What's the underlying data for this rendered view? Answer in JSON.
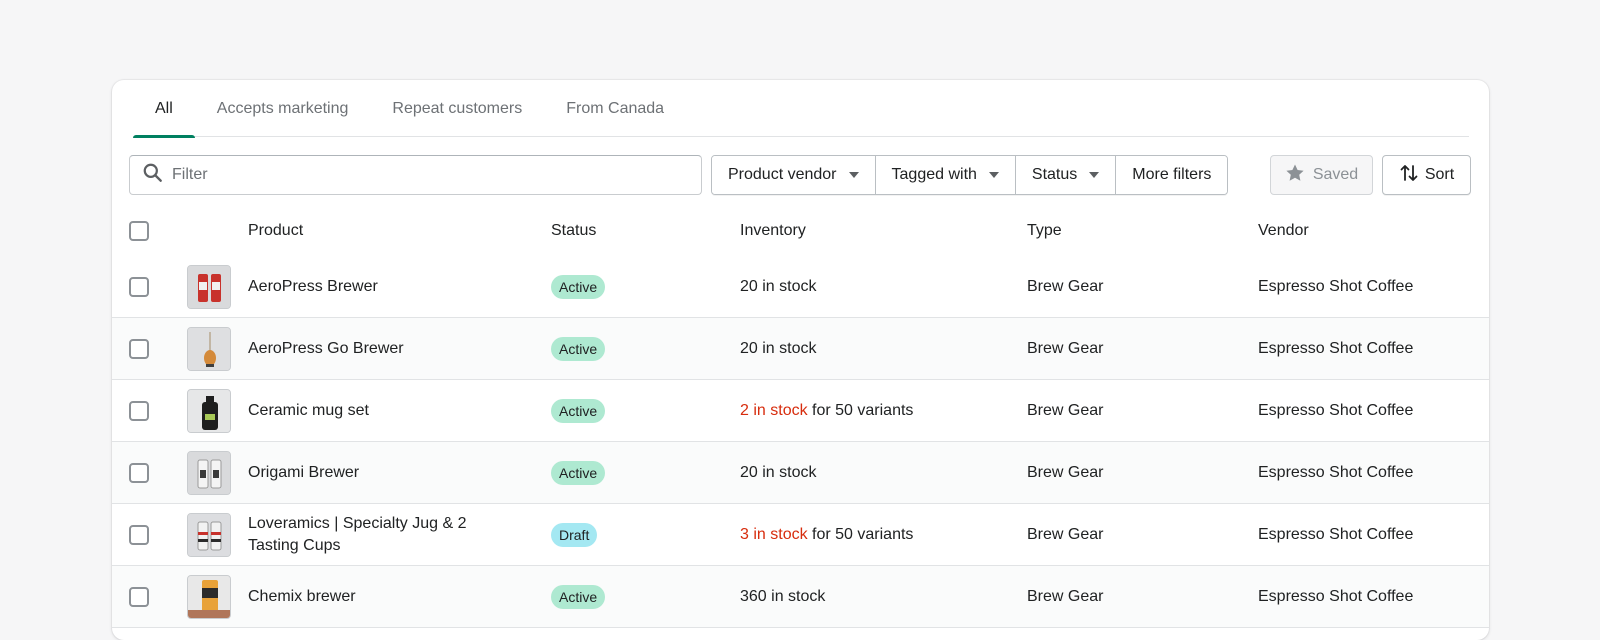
{
  "tabs": [
    {
      "label": "All",
      "active": true
    },
    {
      "label": "Accepts marketing",
      "active": false
    },
    {
      "label": "Repeat customers",
      "active": false
    },
    {
      "label": "From Canada",
      "active": false
    }
  ],
  "filter": {
    "placeholder": "Filter"
  },
  "filter_buttons": {
    "product_vendor": "Product vendor",
    "tagged_with": "Tagged with",
    "status": "Status",
    "more_filters": "More filters"
  },
  "saved_label": "Saved",
  "sort_label": "Sort",
  "columns": {
    "product": "Product",
    "status": "Status",
    "inventory": "Inventory",
    "type": "Type",
    "vendor": "Vendor"
  },
  "rows": [
    {
      "name": "AeroPress Brewer",
      "status": "Active",
      "inv_low": "",
      "inv_text": "20 in stock",
      "type": "Brew Gear",
      "vendor": "Espresso Shot Coffee",
      "thumb_icon": "red-cans-icon"
    },
    {
      "name": "AeroPress Go Brewer",
      "status": "Active",
      "inv_low": "",
      "inv_text": "20 in stock",
      "type": "Brew Gear",
      "vendor": "Espresso Shot Coffee",
      "thumb_icon": "hanging-ornament-icon"
    },
    {
      "name": "Ceramic mug set",
      "status": "Active",
      "inv_low": "2 in stock",
      "inv_text": " for 50 variants",
      "type": "Brew Gear",
      "vendor": "Espresso Shot Coffee",
      "thumb_icon": "black-bottle-icon"
    },
    {
      "name": "Origami Brewer",
      "status": "Active",
      "inv_low": "",
      "inv_text": "20 in stock",
      "type": "Brew Gear",
      "vendor": "Espresso Shot Coffee",
      "thumb_icon": "white-cans-icon"
    },
    {
      "name": "Loveramics | Specialty Jug & 2 Tasting Cups",
      "status": "Draft",
      "inv_low": "3 in stock",
      "inv_text": " for 50 variants",
      "type": "Brew Gear",
      "vendor": "Espresso Shot Coffee",
      "thumb_icon": "striped-cans-icon"
    },
    {
      "name": "Chemix brewer",
      "status": "Active",
      "inv_low": "",
      "inv_text": "360 in stock",
      "type": "Brew Gear",
      "vendor": "Espresso Shot Coffee",
      "thumb_icon": "orange-can-icon"
    }
  ],
  "colors": {
    "accent": "#008060",
    "active_badge": "#aee9d1",
    "draft_badge": "#a4e8f2",
    "critical_text": "#d72c0d"
  }
}
